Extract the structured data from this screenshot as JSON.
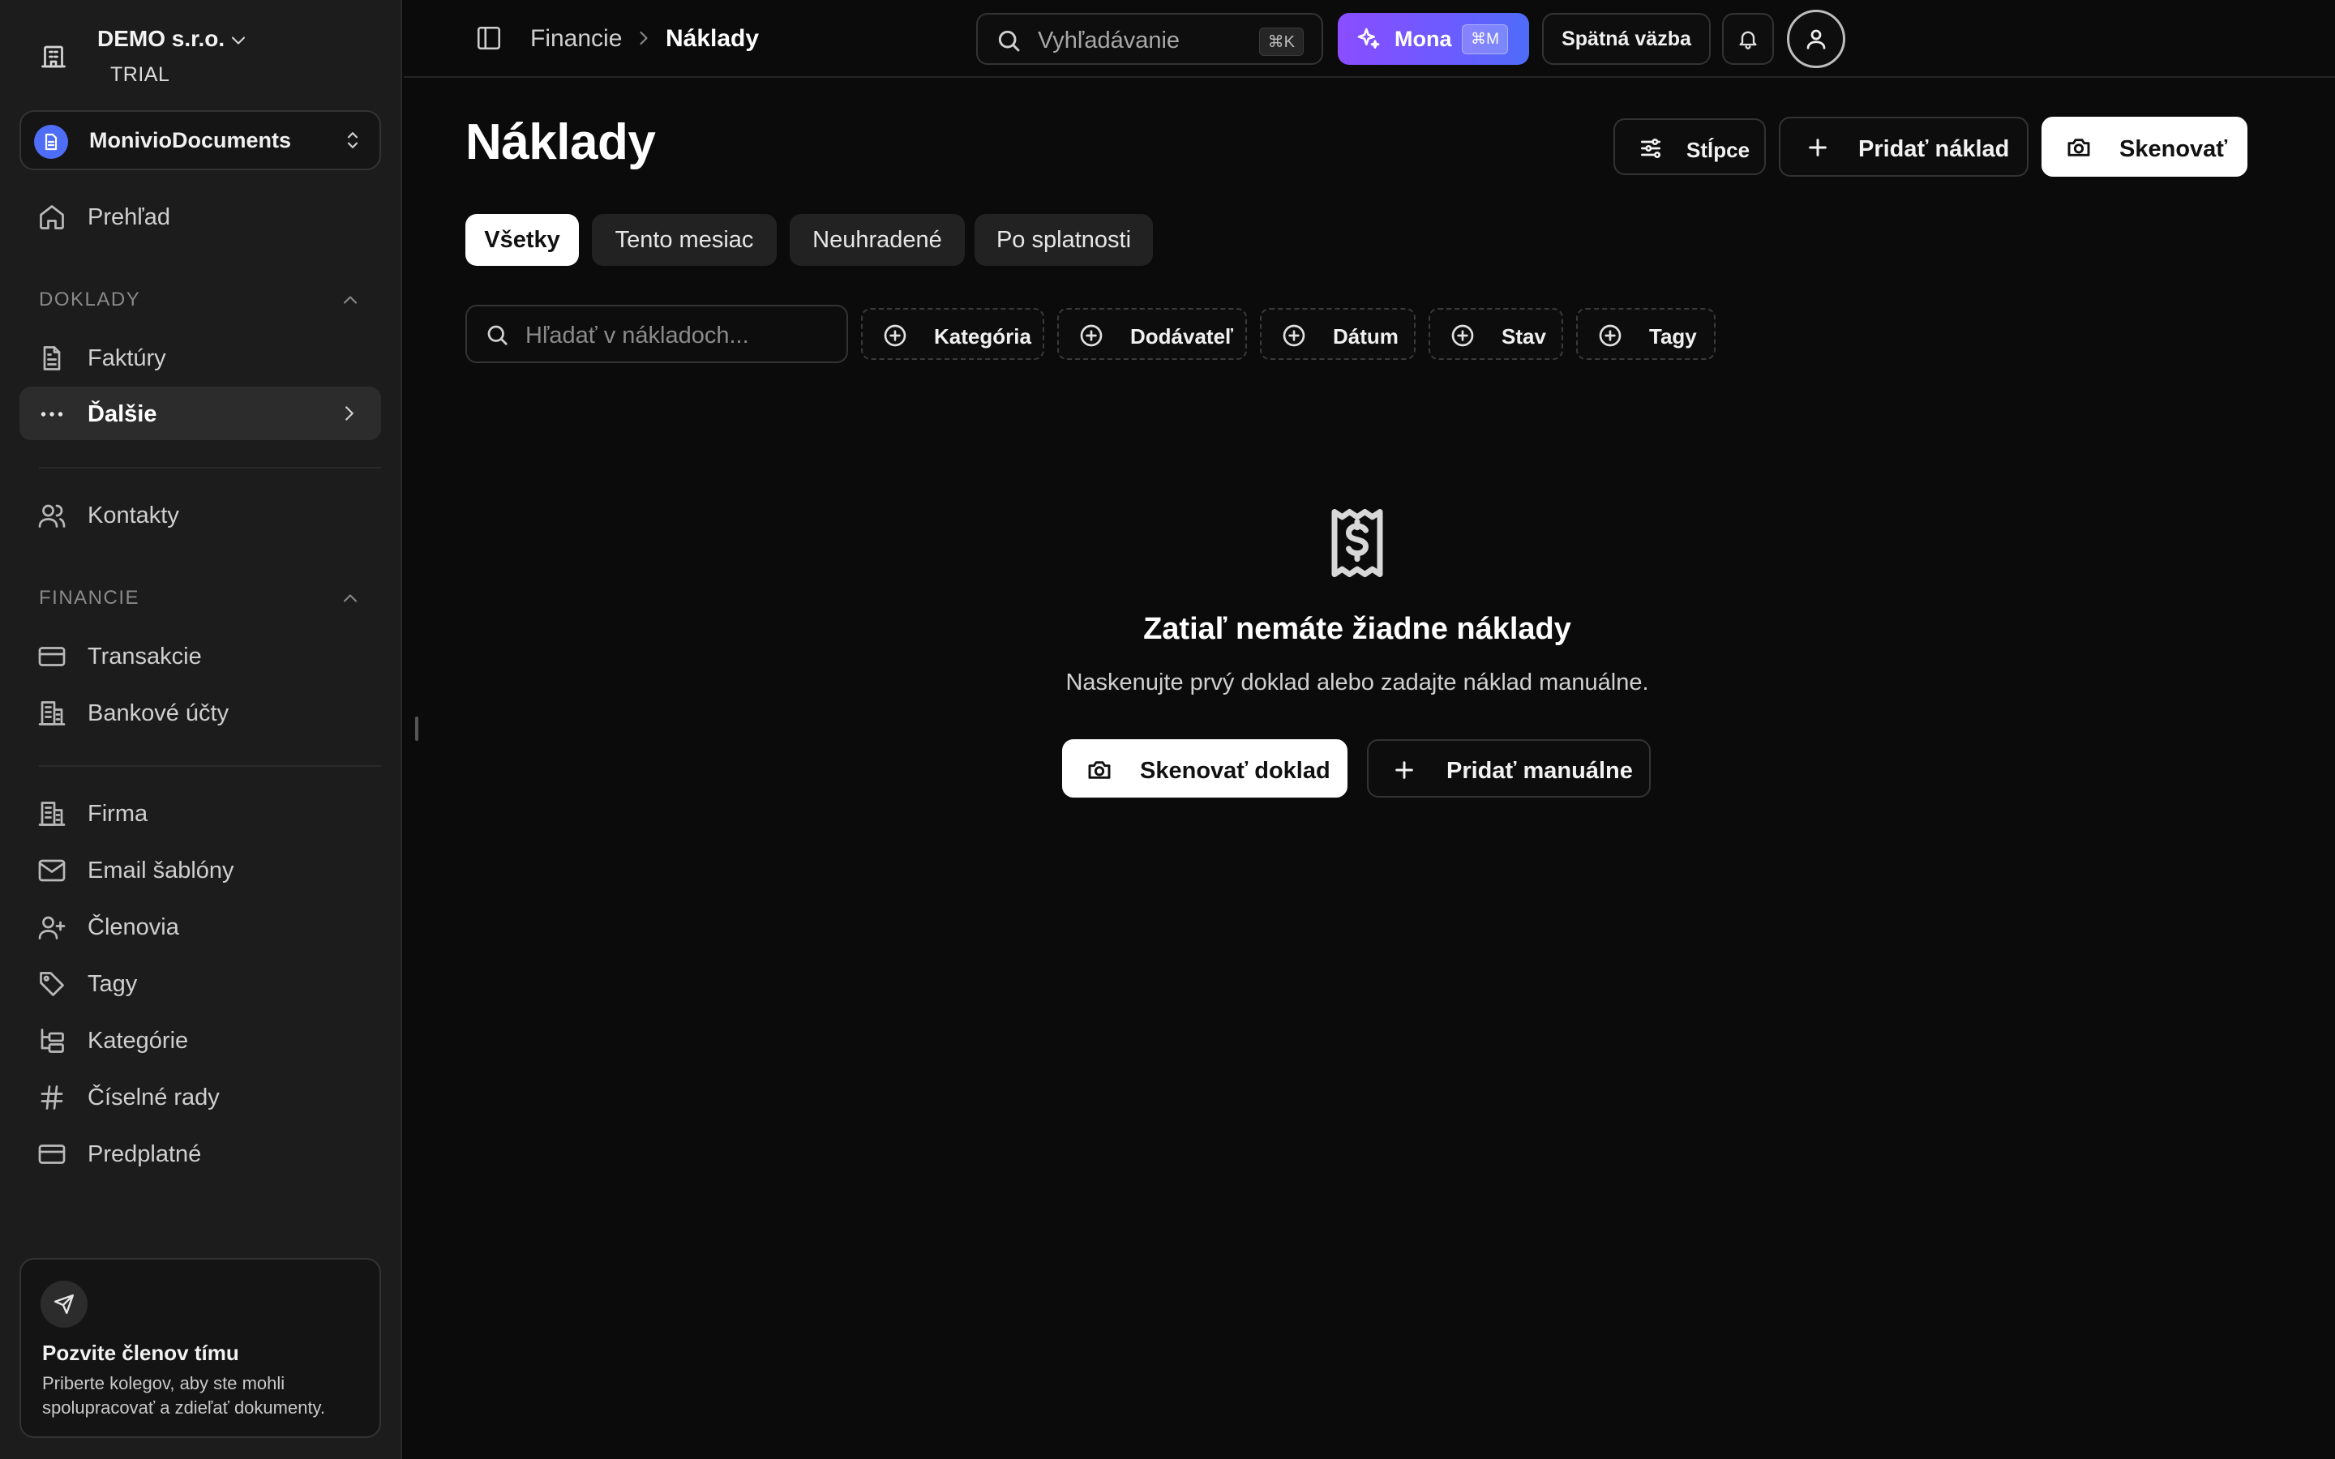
{
  "sidebar": {
    "org_name": "DEMO s.r.o.",
    "org_plan": "TRIAL",
    "workspace": "MonivioDocuments",
    "overview": "Prehľad",
    "section_documents": "DOKLADY",
    "invoices": "Faktúry",
    "more": "Ďalšie",
    "contacts": "Kontakty",
    "section_finance": "FINANCIE",
    "transactions": "Transakcie",
    "bank_accounts": "Bankové účty",
    "company": "Firma",
    "email_templates": "Email šablóny",
    "members": "Členovia",
    "tags": "Tagy",
    "categories": "Kategórie",
    "number_series": "Číselné rady",
    "subscription": "Predplatné",
    "invite": {
      "title": "Pozvite členov tímu",
      "text": "Priberte kolegov, aby ste mohli spolupracovať a zdieľať dokumenty."
    }
  },
  "topbar": {
    "breadcrumb_parent": "Financie",
    "breadcrumb_current": "Náklady",
    "search_placeholder": "Vyhľadávanie",
    "search_shortcut": "⌘K",
    "assistant_label": "Mona",
    "assistant_shortcut": "⌘M",
    "feedback_label": "Spätná väzba"
  },
  "main": {
    "title": "Náklady",
    "columns_label": "Stĺpce",
    "add_expense_label": "Pridať náklad",
    "scan_label": "Skenovať",
    "tabs": [
      "Všetky",
      "Tento mesiac",
      "Neuhradené",
      "Po splatnosti"
    ],
    "filter_search_placeholder": "Hľadať v nákladoch...",
    "filters": [
      "Kategória",
      "Dodávateľ",
      "Dátum",
      "Stav",
      "Tagy"
    ],
    "empty": {
      "title": "Zatiaľ nemáte žiadne náklady",
      "text": "Naskenujte prvý doklad alebo zadajte náklad manuálne.",
      "scan_button": "Skenovať doklad",
      "manual_button": "Pridať manuálne"
    }
  },
  "colors": {
    "background": "#0b0b0b",
    "sidebar": "#1c1c1c",
    "accent_gradient_start": "#8a4dff",
    "accent_gradient_end": "#4e6cf8",
    "workspace_badge": "#4f6ef7"
  }
}
